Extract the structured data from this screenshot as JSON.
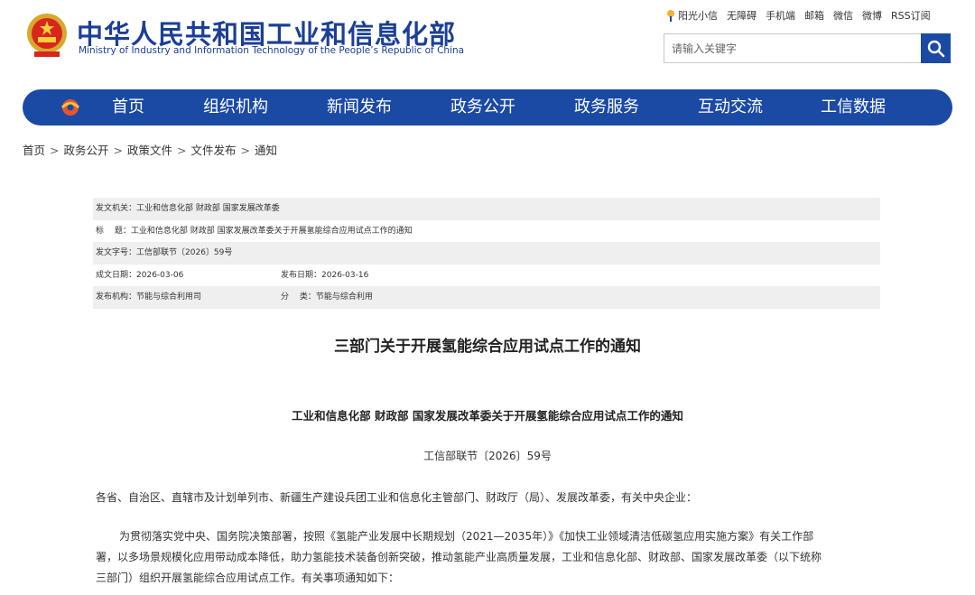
{
  "header": {
    "site_title": "中华人民共和国工业和信息化部",
    "site_subtitle": "Ministry of Industry and Information Technology of the People’s Republic of China",
    "top_links": [
      "阳光小信",
      "无障碍",
      "手机端",
      "邮箱",
      "微信",
      "微博",
      "RSS订阅"
    ],
    "search_placeholder": "请输入关键字"
  },
  "nav": {
    "items": [
      "首页",
      "组织机构",
      "新闻发布",
      "政务公开",
      "政务服务",
      "互动交流",
      "工信数据"
    ]
  },
  "breadcrumb": [
    "首页",
    "政务公开",
    "政策文件",
    "文件发布",
    "通知"
  ],
  "meta": {
    "issuer_label": "发文机关：",
    "issuer": "工业和信息化部 财政部 国家发展改革委",
    "title_label": "标　 题：",
    "title": "工业和信息化部 财政部 国家发展改革委关于开展氢能综合应用试点工作的通知",
    "docno_label": "发文字号：",
    "docno": "工信部联节〔2026〕59号",
    "written_label": "成文日期：",
    "written": "2026-03-06",
    "published_label": "发布日期：",
    "published": "2026-03-16",
    "org_label": "发布机构：",
    "org": "节能与综合利用司",
    "category_label": "分　 类：",
    "category": "节能与综合利用"
  },
  "article": {
    "title": "三部门关于开展氢能综合应用试点工作的通知",
    "subtitle": "工业和信息化部 财政部 国家发展改革委关于开展氢能综合应用试点工作的通知",
    "doc_no": "工信部联节〔2026〕59号",
    "addressee": "各省、自治区、直辖市及计划单列市、新疆生产建设兵团工业和信息化主管部门、财政厅（局）、发展改革委，有关中央企业：",
    "para_lines": [
      "为贯彻落实党中央、国务院决策部署，按照《氢能产业发展中长期规划（2021—2035年）》《加快工业领域清洁低碳氢应用实施方案》有关工作部",
      "署，以多场景规模化应用带动成本降低，助力氢能技术装备创新突破，推动氢能产业高质量发展，工业和信息化部、财政部、国家发展改革委（以下统称",
      "三部门）组织开展氢能综合应用试点工作。有关事项通知如下："
    ]
  }
}
